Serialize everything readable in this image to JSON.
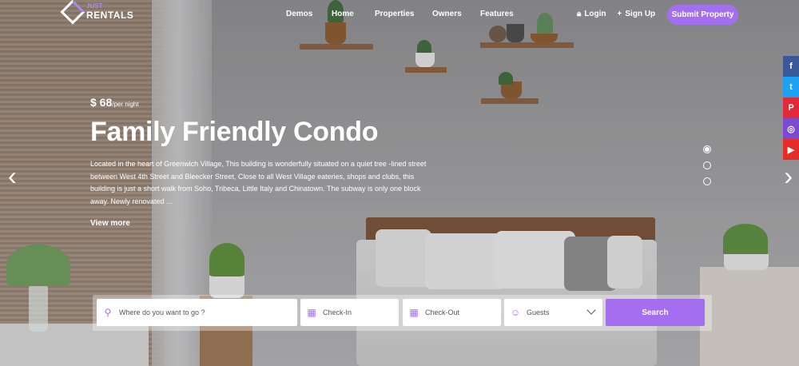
{
  "brand": {
    "top_text": "JUST",
    "name": "RENTALS"
  },
  "nav": [
    "Demos",
    "Home",
    "Properties",
    "Owners",
    "Features"
  ],
  "auth": {
    "login": "Login",
    "signup": "Sign Up"
  },
  "submit_property": "Submit Property",
  "social": [
    {
      "icon": "facebook-icon",
      "glyph": "f",
      "color": "#3b5998"
    },
    {
      "icon": "twitter-icon",
      "glyph": "t",
      "color": "#1da1f2"
    },
    {
      "icon": "pinterest-icon",
      "glyph": "P",
      "color": "#e02a3a"
    },
    {
      "icon": "instagram-icon",
      "glyph": "◎",
      "color": "#7a4bd0"
    },
    {
      "icon": "youtube-icon",
      "glyph": "▶",
      "color": "#e52d27"
    }
  ],
  "hero": {
    "price": "$ 68",
    "price_unit": "/per night",
    "title": "Family Friendly Condo",
    "description": "Located in the heart of Greenwich Village, This building is wonderfully situated on a quiet tree -lined street between West 4th Street and Bleecker Street, Close to all West Village eateries, shops and clubs, this building is just a short walk from Soho, Tribeca, Little Italy and Chinatown. The subway is only one block away. Newly renovated ...",
    "view_more": "View more",
    "prev": "‹",
    "next": "›",
    "slide_count": 3,
    "active_slide": 1
  },
  "search": {
    "location_placeholder": "Where do you want to go ?",
    "checkin_placeholder": "Check-In",
    "checkout_placeholder": "Check-Out",
    "guests_label": "Guests",
    "button": "Search"
  },
  "colors": {
    "accent": "#a46ef0"
  }
}
